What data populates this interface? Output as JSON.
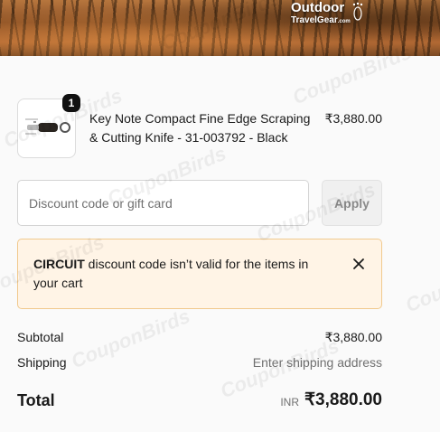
{
  "header": {
    "brand_top": "Outdoor",
    "brand_bottom": "TravelGear",
    "brand_domain": ".com"
  },
  "cart": {
    "item": {
      "quantity": "1",
      "name": "Key Note Compact Fine Edge Scraping & Cutting Knife - 31-003792 - Black",
      "price": "₹3,880.00"
    }
  },
  "discount": {
    "placeholder": "Discount code or gift card",
    "value": "",
    "apply_label": "Apply"
  },
  "alert": {
    "code": "CIRCUIT",
    "message": " discount code isn’t valid for the items in your cart",
    "close_icon": "close-icon"
  },
  "summary": {
    "subtotal_label": "Subtotal",
    "subtotal_value": "₹3,880.00",
    "shipping_label": "Shipping",
    "shipping_value": "Enter shipping address",
    "total_label": "Total",
    "total_currency": "INR",
    "total_value": "₹3,880.00"
  },
  "watermark": "CouponBirds",
  "colors": {
    "alert_bg": "#fff4e6",
    "alert_border": "#f1c98d",
    "badge": "#111111"
  }
}
